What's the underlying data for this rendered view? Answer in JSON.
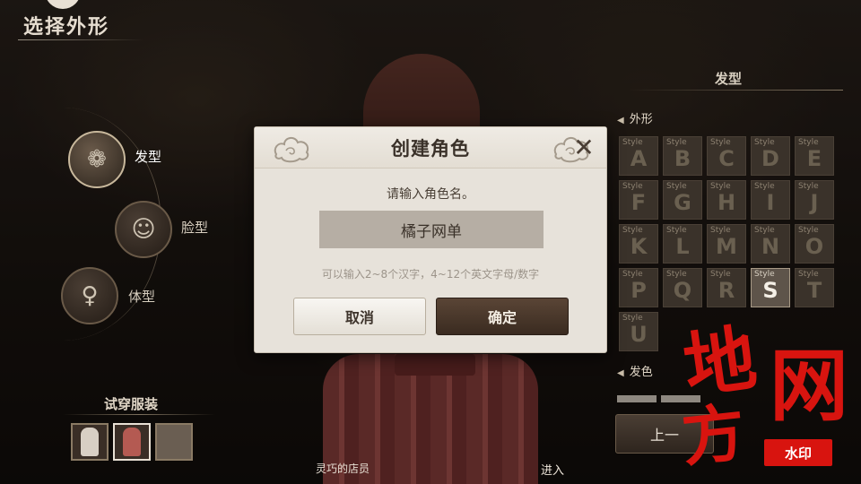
{
  "screen": {
    "title": "选择外形"
  },
  "categories": [
    {
      "label": "发型",
      "icon": "hair-icon",
      "active": true
    },
    {
      "label": "脸型",
      "icon": "face-icon",
      "active": false
    },
    {
      "label": "体型",
      "icon": "body-icon",
      "active": false
    }
  ],
  "tryon": {
    "title": "试穿服装"
  },
  "right_panel": {
    "title": "发型",
    "section_appearance": "外形",
    "section_color": "发色",
    "style_tag": "Style",
    "styles": [
      "A",
      "B",
      "C",
      "D",
      "E",
      "F",
      "G",
      "H",
      "I",
      "J",
      "K",
      "L",
      "M",
      "N",
      "O",
      "P",
      "Q",
      "R",
      "S",
      "T",
      "U"
    ],
    "selected_style": "S",
    "prev_button": "上一"
  },
  "footer": {
    "npc_name": "灵巧的店员",
    "enter": "进入"
  },
  "modal": {
    "title": "创建角色",
    "prompt": "请输入角色名。",
    "name_value": "橘子网单",
    "hint": "可以输入2~8个汉字，4~12个英文字母/数字",
    "cancel": "取消",
    "confirm": "确定"
  },
  "watermark": {
    "char1": "地",
    "char2": "网",
    "char3": "方",
    "tag": "水印"
  },
  "colors": {
    "modal_bg": "#e7e2da",
    "confirm_btn": "#4a3828",
    "watermark": "#d8140f"
  }
}
